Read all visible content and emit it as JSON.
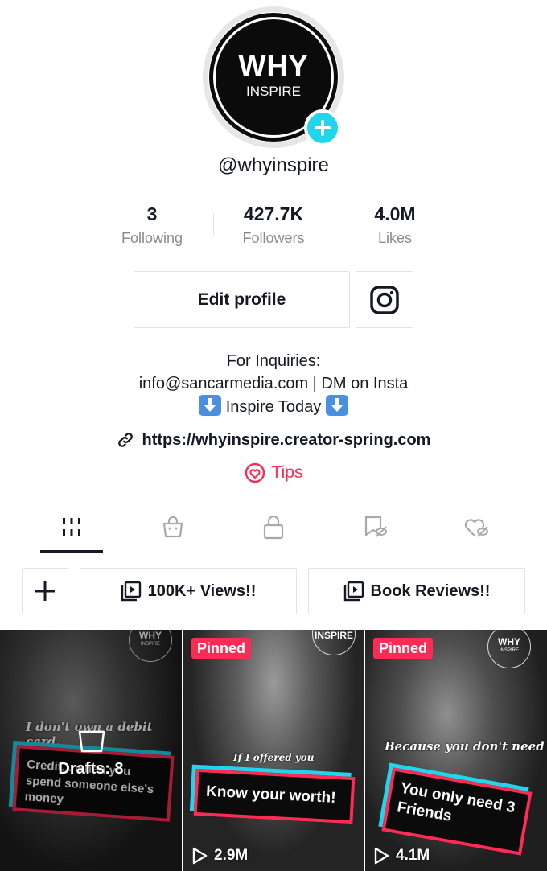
{
  "profile": {
    "avatar_line1": "WHY",
    "avatar_line2": "INSPIRE",
    "username": "@whyinspire"
  },
  "stats": [
    {
      "value": "3",
      "label": "Following"
    },
    {
      "value": "427.7K",
      "label": "Followers"
    },
    {
      "value": "4.0M",
      "label": "Likes"
    }
  ],
  "actions": {
    "edit_profile": "Edit profile",
    "instagram_icon": "instagram-icon"
  },
  "bio": {
    "line1": "For Inquiries:",
    "line2": "info@sancarmedia.com | DM on Insta",
    "line3": "Inspire Today",
    "link": "https://whyinspire.creator-spring.com",
    "tips": "Tips"
  },
  "tabs": [
    {
      "icon": "grid-icon",
      "active": true
    },
    {
      "icon": "shopping-bag-icon",
      "active": false
    },
    {
      "icon": "lock-icon",
      "active": false
    },
    {
      "icon": "hidden-bookmark-icon",
      "active": false
    },
    {
      "icon": "hidden-heart-icon",
      "active": false
    }
  ],
  "playlists": [
    {
      "label": "100K+ Views!!"
    },
    {
      "label": "Book Reviews!!"
    }
  ],
  "videos": [
    {
      "drafts_label": "Drafts: 8",
      "watermark_line1": "WHY",
      "watermark_line2": "INSPIRE",
      "caption_top": "I don't own a debit card.",
      "caption_box": "Credit... when you spend someone else's money"
    },
    {
      "pinned": "Pinned",
      "watermark_line2": "INSPIRE",
      "caption_top": "If I offered you",
      "caption_box": "Know your worth!",
      "views": "2.9M"
    },
    {
      "pinned": "Pinned",
      "watermark_line1": "WHY",
      "watermark_line2": "INSPIRE",
      "caption_top": "Because you don't need",
      "caption_box": "You only need 3 Friends",
      "views": "4.1M"
    }
  ],
  "colors": {
    "accent_red": "#fe2c55",
    "accent_cyan": "#20d5ec",
    "text_primary": "#161823",
    "text_secondary": "#8a8b91"
  }
}
